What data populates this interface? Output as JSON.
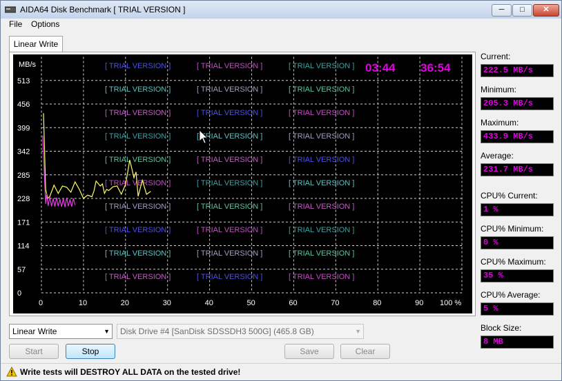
{
  "window": {
    "title": "AIDA64 Disk Benchmark  [ TRIAL VERSION ]",
    "minimize": "─",
    "maximize": "□",
    "close": "✕"
  },
  "menu": {
    "file": "File",
    "options": "Options"
  },
  "tab": {
    "label": "Linear Write"
  },
  "chart": {
    "watermark": "[ TRIAL VERSION ]",
    "elapsed": "03:44",
    "remaining": "36:54",
    "ylabel": "MB/s",
    "y_ticks": [
      "513",
      "456",
      "399",
      "342",
      "285",
      "228",
      "171",
      "114",
      "57",
      "0"
    ],
    "x_ticks": [
      "0",
      "10",
      "20",
      "30",
      "40",
      "50",
      "60",
      "70",
      "80",
      "90",
      "100 %"
    ],
    "watermark_colors": [
      "#5050e0",
      "#c050c0",
      "#40a0a0",
      "#60c0c0",
      "#a0a0c0",
      "#60c0a0",
      "#c060c0"
    ]
  },
  "chart_data": {
    "type": "line",
    "xlabel": "",
    "ylabel": "MB/s",
    "xlim": [
      0,
      100
    ],
    "ylim": [
      0,
      570
    ],
    "grid": true,
    "series": [
      {
        "color": "#ffff60",
        "x": [
          0.5,
          1,
          1.5,
          2,
          3,
          4,
          5,
          6,
          7,
          8,
          9,
          10,
          11,
          12,
          12.5,
          13,
          14,
          14.5,
          15,
          15.5,
          16,
          17,
          18,
          19,
          20,
          20.5,
          21,
          21.5,
          22,
          22.5,
          23,
          24,
          25,
          26
        ],
        "y": [
          434,
          250,
          228,
          233,
          260,
          240,
          258,
          255,
          243,
          268,
          250,
          228,
          236,
          232,
          246,
          270,
          258,
          263,
          240,
          250,
          247,
          256,
          258,
          238,
          262,
          290,
          321,
          300,
          278,
          292,
          233,
          272,
          238,
          245
        ]
      },
      {
        "color": "#e040e0",
        "x": [
          0.3,
          1,
          1.2,
          1.6,
          2.0,
          2.4,
          2.8,
          3.2,
          3.6,
          4.0,
          4.4,
          4.8,
          5.2,
          5.6,
          6.0,
          6.4,
          6.8,
          7.2,
          7.6,
          8.0
        ],
        "y": [
          380,
          215,
          240,
          210,
          232,
          209,
          228,
          208,
          230,
          209,
          226,
          208,
          228,
          207,
          230,
          209,
          226,
          208,
          228,
          212
        ]
      }
    ]
  },
  "stats": {
    "current_label": "Current:",
    "current": "222.5 MB/s",
    "minimum_label": "Minimum:",
    "minimum": "205.3 MB/s",
    "maximum_label": "Maximum:",
    "maximum": "433.9 MB/s",
    "average_label": "Average:",
    "average": "231.7 MB/s",
    "cpu_current_label": "CPU% Current:",
    "cpu_current": "1 %",
    "cpu_minimum_label": "CPU% Minimum:",
    "cpu_minimum": "0 %",
    "cpu_maximum_label": "CPU% Maximum:",
    "cpu_maximum": "35 %",
    "cpu_average_label": "CPU% Average:",
    "cpu_average": "5 %",
    "block_label": "Block Size:",
    "block": "8 MB"
  },
  "controls": {
    "mode": "Linear Write",
    "drive": "Disk Drive #4  [SanDisk SDSSDH3 500G]  (465.8 GB)",
    "start": "Start",
    "stop": "Stop",
    "save": "Save",
    "clear": "Clear"
  },
  "status": {
    "warning": "Write tests will DESTROY ALL DATA on the tested drive!"
  }
}
